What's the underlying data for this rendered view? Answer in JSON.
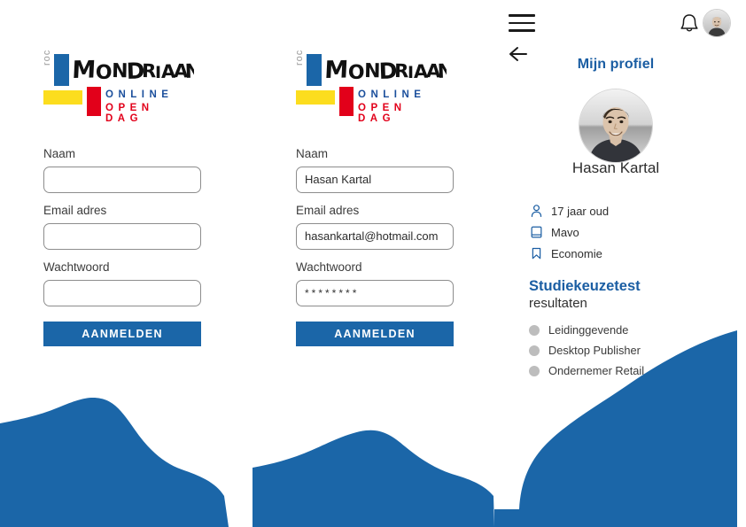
{
  "colors": {
    "brand_blue": "#1b66a8",
    "title_blue": "#1b5ea3",
    "logo_blue": "#1b4f9c",
    "logo_red": "#e2001a",
    "logo_yellow": "#fcdd1e",
    "bullet_gray": "#bdbdbd"
  },
  "logo": {
    "roc": "roc",
    "wordmark": "MONDRIAAN",
    "online": "ONLINE",
    "open_dag": "OPEN DAG"
  },
  "form_empty": {
    "name_label": "Naam",
    "name_value": "",
    "email_label": "Email adres",
    "email_value": "",
    "password_label": "Wachtwoord",
    "password_value": "",
    "submit_label": "AANMELDEN"
  },
  "form_filled": {
    "name_label": "Naam",
    "name_value": "Hasan Kartal",
    "email_label": "Email adres",
    "email_value": "hasankartal@hotmail.com",
    "password_label": "Wachtwoord",
    "password_value": "********",
    "submit_label": "AANMELDEN"
  },
  "profile": {
    "menu_icon": "hamburger-menu-icon",
    "back_icon": "arrow-left-icon",
    "bell_icon": "notification-bell-icon",
    "avatar_icon": "user-avatar",
    "title": "Mijn profiel",
    "name": "Hasan Kartal",
    "info": [
      {
        "icon": "person-icon",
        "text": "17 jaar oud"
      },
      {
        "icon": "book-icon",
        "text": "Mavo"
      },
      {
        "icon": "bookmark-icon",
        "text": "Economie"
      }
    ],
    "results_title": "Studiekeuzetest",
    "results_subtitle": "resultaten",
    "results": [
      {
        "label": "Leidinggevende"
      },
      {
        "label": "Desktop Publisher"
      },
      {
        "label": "Ondernemer Retail"
      }
    ]
  }
}
